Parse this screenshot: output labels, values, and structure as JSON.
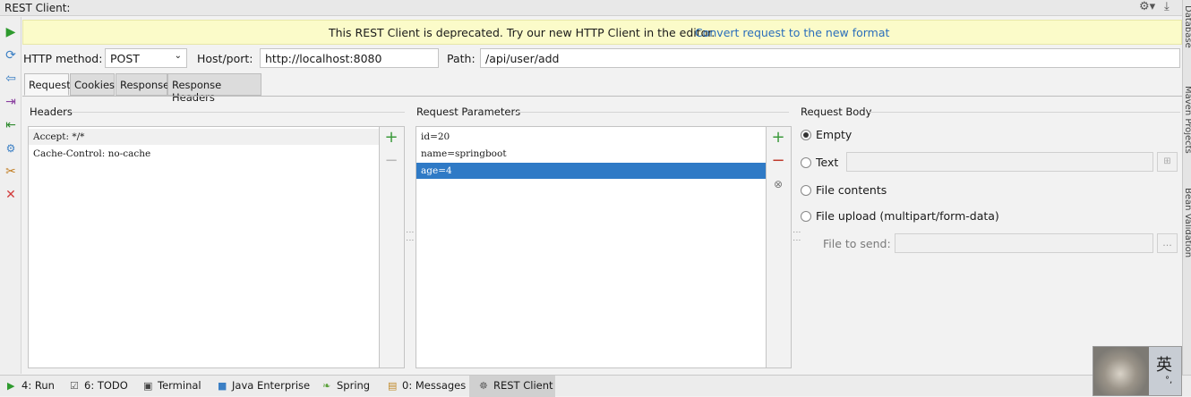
{
  "window": {
    "title": "REST Client:"
  },
  "right_strip": [
    "Database",
    "Maven Projects",
    "Bean Validation"
  ],
  "left_toolbar": [
    "run-icon",
    "refresh-icon",
    "back-icon",
    "export-icon",
    "import-icon",
    "settings-icon",
    "config-icon",
    "close-icon"
  ],
  "banner": {
    "message": "This REST Client is deprecated. Try our new HTTP Client in the editor.",
    "link": "Convert request to the new format"
  },
  "request_line": {
    "method_label": "HTTP method:",
    "method_value": "POST",
    "host_label": "Host/port:",
    "host_value": "http://localhost:8080",
    "path_label": "Path:",
    "path_value": "/api/user/add"
  },
  "tabs": [
    "Request",
    "Cookies",
    "Response",
    "Response Headers"
  ],
  "headers": {
    "title": "Headers",
    "rows": [
      "Accept: */*",
      "Cache-Control: no-cache"
    ]
  },
  "params": {
    "title": "Request Parameters",
    "rows": [
      "id=20",
      "name=springboot",
      "age=4"
    ],
    "selected_index": 2
  },
  "body": {
    "title": "Request Body",
    "options": [
      "Empty",
      "Text",
      "File contents",
      "File upload (multipart/form-data)"
    ],
    "selected": "Empty",
    "file_label": "File to send:",
    "browse_label": "..."
  },
  "statusbar": {
    "items": [
      {
        "label": "4: Run",
        "icon": "run-icon"
      },
      {
        "label": "6: TODO",
        "icon": "todo-icon"
      },
      {
        "label": "Terminal",
        "icon": "terminal-icon"
      },
      {
        "label": "Java Enterprise",
        "icon": "java-enterprise-icon"
      },
      {
        "label": "Spring",
        "icon": "spring-icon"
      },
      {
        "label": "0: Messages",
        "icon": "messages-icon"
      },
      {
        "label": "REST Client",
        "icon": "rest-client-icon"
      }
    ],
    "active": "REST Client"
  },
  "ime": {
    "char": "英"
  },
  "colors": {
    "accent": "#2f7ac6",
    "banner_bg": "#fbfbc9",
    "link": "#2a6ebb",
    "add": "#3c9a3c",
    "remove": "#c0392b"
  }
}
